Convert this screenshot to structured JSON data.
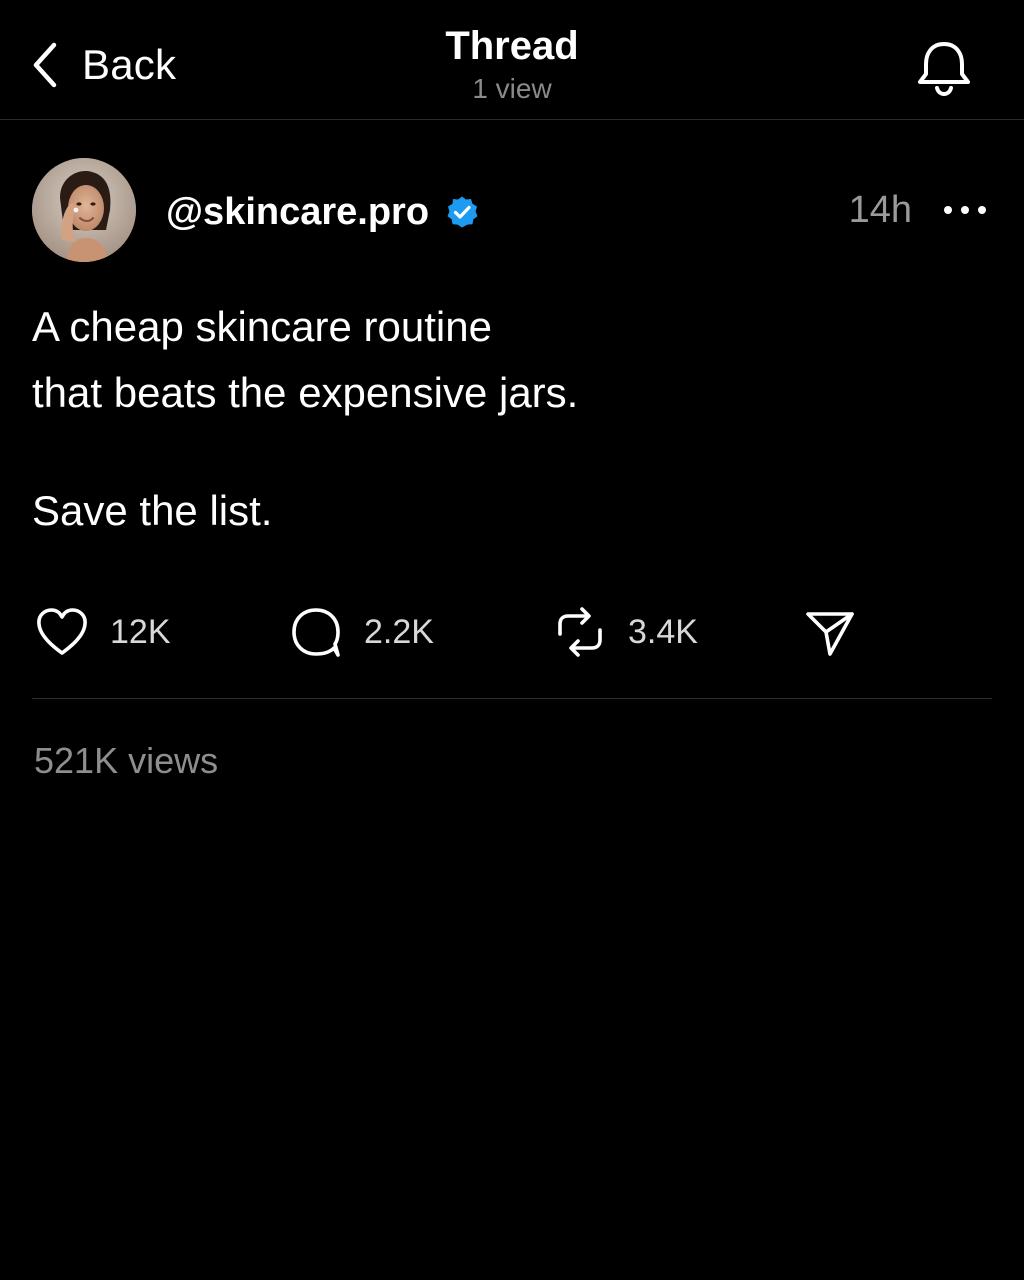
{
  "header": {
    "back_label": "Back",
    "title": "Thread",
    "subtitle": "1 view",
    "icons": {
      "back": "chevron-left-icon",
      "notifications": "bell-icon"
    }
  },
  "post": {
    "username": "@skincare.pro",
    "verified": true,
    "timestamp": "14h",
    "body": {
      "line1": "A cheap skincare routine",
      "line2": "that beats the expensive jars.",
      "line3": "Save the list."
    },
    "actions": {
      "likes": "12K",
      "replies": "2.2K",
      "reposts": "3.4K"
    },
    "views": "521K views"
  },
  "colors": {
    "background": "#000000",
    "text_primary": "#ffffff",
    "text_secondary": "#8e8e8e",
    "verified_badge": "#1d9bf0",
    "divider": "#2e2e2e"
  }
}
